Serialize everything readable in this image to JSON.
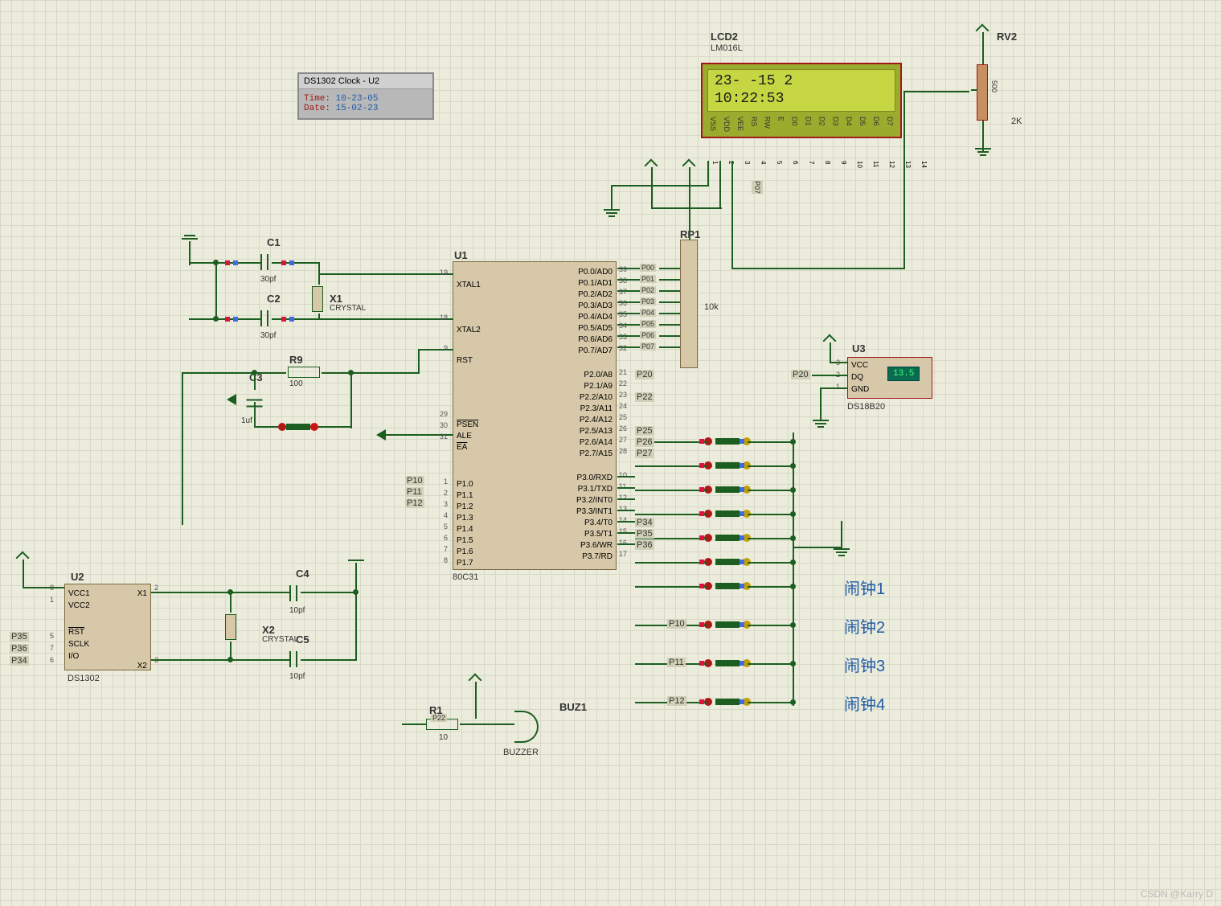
{
  "debug": {
    "title": "DS1302 Clock - U2",
    "time_lbl": "Time:",
    "time_val": "10-23-05",
    "date_lbl": "Date:",
    "date_val": "15-02-23"
  },
  "lcd": {
    "ref": "LCD2",
    "part": "LM016L",
    "line1": "23-  -15 2",
    "line2": "10:22:53",
    "pins_text": [
      "VSS",
      "VDD",
      "VEE",
      "RS",
      "RW",
      "E",
      "D0",
      "D1",
      "D2",
      "D3",
      "D4",
      "D5",
      "D6",
      "D7"
    ],
    "pins_num": [
      "1",
      "2",
      "3",
      "4",
      "5",
      "6",
      "7",
      "8",
      "9",
      "10",
      "11",
      "12",
      "13",
      "14"
    ]
  },
  "u1": {
    "ref": "U1",
    "part": "80C31",
    "left_pins": [
      {
        "n": "19",
        "t": "XTAL1"
      },
      {
        "n": "18",
        "t": "XTAL2"
      },
      {
        "n": "9",
        "t": "RST"
      },
      {
        "n": "29",
        "t": "PSEN"
      },
      {
        "n": "30",
        "t": "ALE"
      },
      {
        "n": "31",
        "t": "EA"
      }
    ],
    "left_p1": [
      {
        "n": "1",
        "t": "P1.0"
      },
      {
        "n": "2",
        "t": "P1.1"
      },
      {
        "n": "3",
        "t": "P1.2"
      },
      {
        "n": "4",
        "t": "P1.3"
      },
      {
        "n": "5",
        "t": "P1.4"
      },
      {
        "n": "6",
        "t": "P1.5"
      },
      {
        "n": "7",
        "t": "P1.6"
      },
      {
        "n": "8",
        "t": "P1.7"
      }
    ],
    "right_p0": [
      {
        "n": "39",
        "t": "P0.0/AD0"
      },
      {
        "n": "38",
        "t": "P0.1/AD1"
      },
      {
        "n": "37",
        "t": "P0.2/AD2"
      },
      {
        "n": "36",
        "t": "P0.3/AD3"
      },
      {
        "n": "35",
        "t": "P0.4/AD4"
      },
      {
        "n": "34",
        "t": "P0.5/AD5"
      },
      {
        "n": "33",
        "t": "P0.6/AD6"
      },
      {
        "n": "32",
        "t": "P0.7/AD7"
      }
    ],
    "right_p2": [
      {
        "n": "21",
        "t": "P2.0/A8"
      },
      {
        "n": "22",
        "t": "P2.1/A9"
      },
      {
        "n": "23",
        "t": "P2.2/A10"
      },
      {
        "n": "24",
        "t": "P2.3/A11"
      },
      {
        "n": "25",
        "t": "P2.4/A12"
      },
      {
        "n": "26",
        "t": "P2.5/A13"
      },
      {
        "n": "27",
        "t": "P2.6/A14"
      },
      {
        "n": "28",
        "t": "P2.7/A15"
      }
    ],
    "right_p3": [
      {
        "n": "10",
        "t": "P3.0/RXD"
      },
      {
        "n": "11",
        "t": "P3.1/TXD"
      },
      {
        "n": "12",
        "t": "P3.2/INT0"
      },
      {
        "n": "13",
        "t": "P3.3/INT1"
      },
      {
        "n": "14",
        "t": "P3.4/T0"
      },
      {
        "n": "15",
        "t": "P3.5/T1"
      },
      {
        "n": "16",
        "t": "P3.6/WR"
      },
      {
        "n": "17",
        "t": "P3.7/RD"
      }
    ]
  },
  "u2": {
    "ref": "U2",
    "part": "DS1302",
    "pins": [
      "VCC1",
      "VCC2",
      "RST",
      "SCLK",
      "I/O",
      "X1",
      "X2"
    ],
    "nums": {
      "x1": "2",
      "x2": "3",
      "rst": "5",
      "sclk": "7",
      "io": "6",
      "vcc1": "8",
      "vcc2": "1"
    }
  },
  "u3": {
    "ref": "U3",
    "part": "DS18B20",
    "temp": "13.5",
    "pins": [
      "VCC",
      "DQ",
      "GND"
    ],
    "nums": {
      "vcc": "3",
      "dq": "2",
      "gnd": "1"
    }
  },
  "rp1": {
    "ref": "RP1",
    "val": "10k"
  },
  "rv2": {
    "ref": "RV2",
    "val": "2K",
    "res": "500"
  },
  "buzzer": {
    "ref": "BUZ1",
    "part": "BUZZER"
  },
  "caps": {
    "c1": {
      "ref": "C1",
      "val": "30pf"
    },
    "c2": {
      "ref": "C2",
      "val": "30pf"
    },
    "c3": {
      "ref": "C3",
      "val": "1uf"
    },
    "c4": {
      "ref": "C4",
      "val": "10pf"
    },
    "c5": {
      "ref": "C5",
      "val": "10pf"
    }
  },
  "crystals": {
    "x1": {
      "ref": "X1",
      "part": "CRYSTAL"
    },
    "x2": {
      "ref": "X2",
      "part": "CRYSTAL"
    }
  },
  "resistors": {
    "r1": {
      "ref": "R1",
      "val": "10"
    },
    "r9": {
      "ref": "R9",
      "val": "100"
    }
  },
  "nets": {
    "p0": [
      "P00",
      "P01",
      "P02",
      "P03",
      "P04",
      "P05",
      "P06",
      "P07"
    ],
    "p2": [
      "P20",
      "P22",
      "P25",
      "P26",
      "P27"
    ],
    "p3": [
      "P34",
      "P35",
      "P36"
    ],
    "p1": [
      "P10",
      "P11",
      "P12"
    ],
    "u2nets": [
      "P35",
      "P36",
      "P34"
    ],
    "lcd_nets": [
      "P26",
      "P25",
      "P27",
      "P00",
      "P01",
      "P02",
      "P03",
      "P04",
      "P05",
      "P06",
      "P07"
    ],
    "u3net": "P20",
    "alarm_btns": [
      "P10",
      "P11",
      "P12"
    ]
  },
  "alarms": [
    "闹钟1",
    "闹钟2",
    "闹钟3",
    "闹钟4"
  ],
  "watermark": "CSDN @Karry D"
}
